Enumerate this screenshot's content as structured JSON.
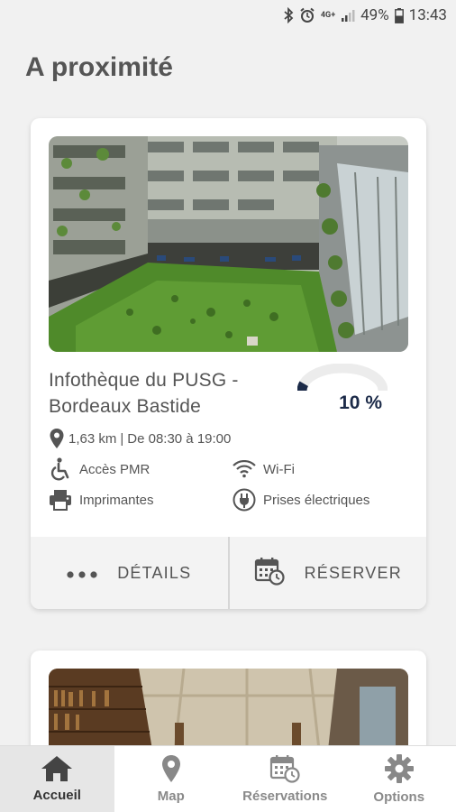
{
  "status_bar": {
    "battery": "49%",
    "time": "13:43",
    "network": "4G+"
  },
  "page": {
    "title": "A proximité"
  },
  "cards": [
    {
      "name": "Infothèque du PUSG - Bordeaux Bastide",
      "occupancy_label": "10 %",
      "occupancy": 0.1,
      "distance": "1,63 km",
      "separator": "|",
      "hours": "De 08:30 à 19:00",
      "amenities": [
        {
          "label": "Accès PMR",
          "icon": "wheelchair-icon"
        },
        {
          "label": "Wi-Fi",
          "icon": "wifi-icon"
        },
        {
          "label": "Imprimantes",
          "icon": "printer-icon"
        },
        {
          "label": "Prises électriques",
          "icon": "power-plug-icon"
        }
      ],
      "actions": {
        "details_label": "DÉTAILS",
        "reserve_label": "RÉSERVER"
      }
    }
  ],
  "bottom_nav": [
    {
      "label": "Accueil",
      "icon": "home-icon",
      "active": true
    },
    {
      "label": "Map",
      "icon": "map-pin-icon",
      "active": false
    },
    {
      "label": "Réservations",
      "icon": "calendar-clock-icon",
      "active": false
    },
    {
      "label": "Options",
      "icon": "gear-icon",
      "active": false
    }
  ],
  "colors": {
    "accent_dark": "#1b2a48",
    "text": "#555555",
    "background": "#f1f1f1"
  }
}
